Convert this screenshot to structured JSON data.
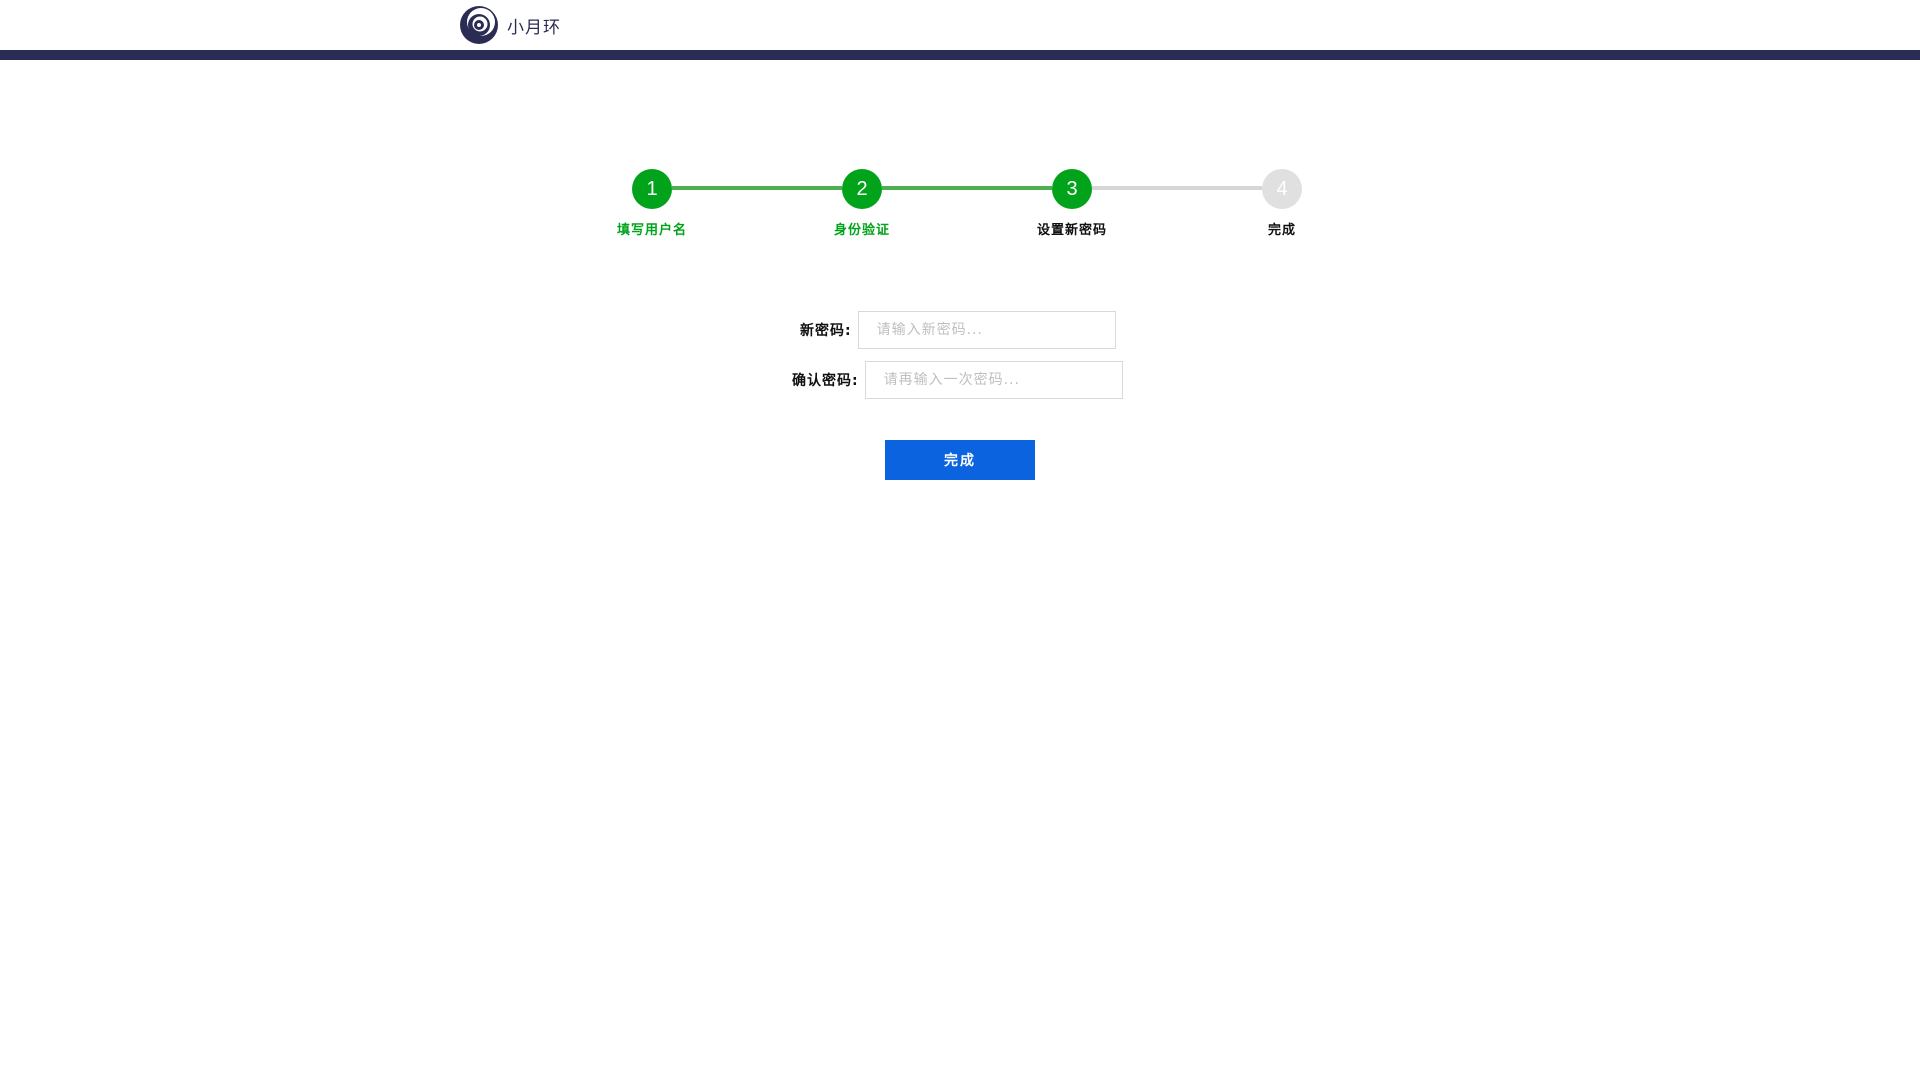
{
  "header": {
    "logo_text": "小月环",
    "logo_icon": "crescent-ring-logo-icon",
    "bar_color": "#2b2c54"
  },
  "steps": {
    "active_color": "#00a31a",
    "inactive_color": "#e0e0e0",
    "items": [
      {
        "number": "1",
        "label": "填写用户名",
        "state": "done"
      },
      {
        "number": "2",
        "label": "身份验证",
        "state": "done"
      },
      {
        "number": "3",
        "label": "设置新密码",
        "state": "current"
      },
      {
        "number": "4",
        "label": "完成",
        "state": "todo"
      }
    ]
  },
  "form": {
    "new_password": {
      "label": "新密码:",
      "placeholder": "请输入新密码...",
      "value": ""
    },
    "confirm_password": {
      "label": "确认密码:",
      "placeholder": "请再输入一次密码...",
      "value": ""
    },
    "submit_label": "完成",
    "submit_color": "#0b63e0"
  }
}
